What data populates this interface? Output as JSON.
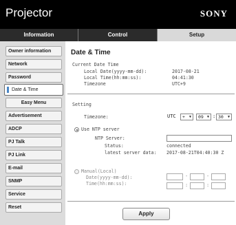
{
  "header": {
    "title": "Projector",
    "brand": "SONY"
  },
  "tabs": [
    {
      "label": "Information"
    },
    {
      "label": "Control"
    },
    {
      "label": "Setup"
    }
  ],
  "sidebar": {
    "items": [
      {
        "label": "Owner information"
      },
      {
        "label": "Network"
      },
      {
        "label": "Password"
      },
      {
        "label": "Date & Time"
      },
      {
        "label": "Easy Menu"
      },
      {
        "label": "Advertisement"
      },
      {
        "label": "ADCP"
      },
      {
        "label": "PJ Talk"
      },
      {
        "label": "PJ Link"
      },
      {
        "label": "E-mail"
      },
      {
        "label": "SNMP"
      },
      {
        "label": "Service"
      },
      {
        "label": "Reset"
      }
    ],
    "active_index": 3
  },
  "main": {
    "title": "Date & Time",
    "current": {
      "heading": "Current Date Time",
      "date_label": "Local Date(yyyy-mm-dd):",
      "date_value": "2017-08-21",
      "time_label": "Local Time(hh:mm:ss):",
      "time_value": "04:41:30",
      "tz_label": "Timezone",
      "tz_value": "UTC+9"
    },
    "setting": {
      "heading": "Setting",
      "timezone_label": "Timezone:",
      "utc_prefix": "UTC",
      "sign_value": "+",
      "hours_value": "09",
      "minutes_value": "30",
      "ntp": {
        "label": "Use NTP server",
        "selected": true,
        "server_label": "NTP Server:",
        "server_value": "",
        "status_label": "Status:",
        "status_value": "connected",
        "latest_label": "latest server data:",
        "latest_value": "2017-08-21T04:40:30 Z"
      },
      "manual": {
        "label": "Manual(Local)",
        "selected": false,
        "date_label": "Date(yyyy-mm-dd):",
        "time_label": "Time(hh:mm:ss):",
        "date_sep": "-",
        "time_sep": ":"
      }
    },
    "apply_label": "Apply"
  },
  "icons": {
    "dropdown": "chevron-down-icon",
    "active_marker": "selection-marker-icon"
  },
  "colors": {
    "header_bg": "#000000",
    "tab_active_bg": "#d9d9d9",
    "sidebar_bg": "#dcdcdc",
    "active_marker": "#4a86c5"
  }
}
